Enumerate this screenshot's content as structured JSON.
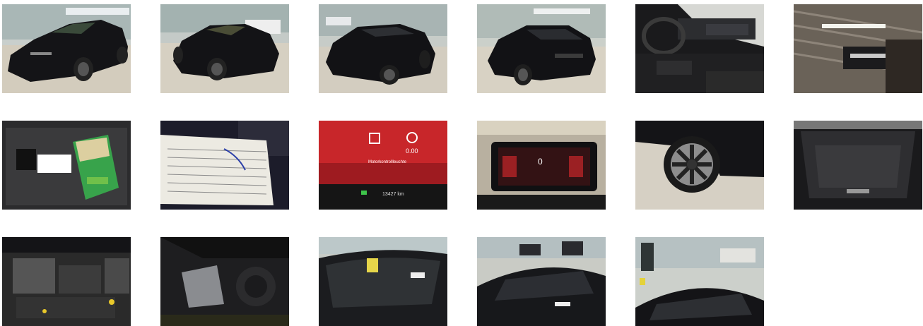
{
  "gallery": {
    "photos": [
      {
        "label": "exterior-front-left"
      },
      {
        "label": "exterior-front-left-2"
      },
      {
        "label": "exterior-rear-left"
      },
      {
        "label": "exterior-rear-left-2"
      },
      {
        "label": "interior-cockpit"
      },
      {
        "label": "ceiling-phone"
      },
      {
        "label": "keys-and-manual"
      },
      {
        "label": "service-document"
      },
      {
        "label": "instrument-cluster"
      },
      {
        "label": "dashboard-display"
      },
      {
        "label": "wheel-rim"
      },
      {
        "label": "trunk"
      },
      {
        "label": "engine-bay"
      },
      {
        "label": "spare-wheel-well"
      },
      {
        "label": "windshield"
      },
      {
        "label": "roof-front"
      },
      {
        "label": "roof-rear"
      }
    ]
  },
  "cluster": {
    "speed": "0.00",
    "warning_line": "Motorkontrollleuchte",
    "odometer": "13427 km"
  },
  "dash_display": {
    "speed": "0"
  },
  "colors": {
    "car_black": "#141417",
    "floor": "#cfc9bd",
    "wall": "#b9c3c2",
    "cluster_red": "#c8262a"
  }
}
